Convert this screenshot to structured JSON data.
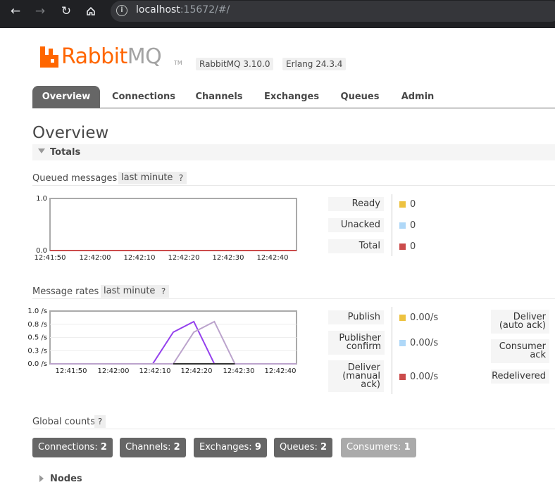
{
  "browser": {
    "url_host": "localhost",
    "url_rest": ":15672/#/"
  },
  "brand": {
    "logo_rabbit": "Rabbit",
    "logo_mq": "MQ",
    "logo_tm": "TM",
    "rabbitmq_version": "RabbitMQ 3.10.0",
    "erlang_version": "Erlang 24.3.4",
    "accent_color": "#ff6600"
  },
  "tabs": [
    {
      "label": "Overview",
      "active": true
    },
    {
      "label": "Connections"
    },
    {
      "label": "Channels"
    },
    {
      "label": "Exchanges"
    },
    {
      "label": "Queues"
    },
    {
      "label": "Admin"
    }
  ],
  "page": {
    "title": "Overview",
    "totals_label": "Totals",
    "help": "?"
  },
  "queued": {
    "heading": "Queued messages",
    "range": "last minute",
    "stats": [
      {
        "label": "Ready",
        "value": "0",
        "color": "#edc240"
      },
      {
        "label": "Unacked",
        "value": "0",
        "color": "#afd8f8"
      },
      {
        "label": "Total",
        "value": "0",
        "color": "#cb4b4b"
      }
    ]
  },
  "rates": {
    "heading": "Message rates",
    "range": "last minute",
    "stats": [
      {
        "label": "Publish",
        "value": "0.00/s",
        "color": "#edc240"
      },
      {
        "label": "Publisher confirm",
        "value": "0.00/s",
        "color": "#afd8f8"
      },
      {
        "label": "Deliver (manual ack)",
        "value": "0.00/s",
        "color": "#cb4b4b"
      }
    ],
    "stats_right": [
      {
        "label": "Deliver (auto ack)"
      },
      {
        "label": "Consumer ack"
      },
      {
        "label": "Redelivered"
      }
    ]
  },
  "global": {
    "heading": "Global counts",
    "counts": [
      {
        "label": "Connections:",
        "value": "2"
      },
      {
        "label": "Channels:",
        "value": "2"
      },
      {
        "label": "Exchanges:",
        "value": "9"
      },
      {
        "label": "Queues:",
        "value": "2"
      },
      {
        "label": "Consumers:",
        "value": "1"
      }
    ]
  },
  "nodes": {
    "label": "Nodes"
  },
  "chart_data": [
    {
      "type": "line",
      "title": "Queued messages",
      "x": [
        "12:41:50",
        "12:42:00",
        "12:42:10",
        "12:42:20",
        "12:42:30",
        "12:42:40"
      ],
      "ylim": [
        0,
        1
      ],
      "yticks": [
        "0.0",
        "1.0"
      ],
      "series": [
        {
          "name": "Ready",
          "color": "#edc240",
          "values": [
            0,
            0,
            0,
            0,
            0,
            0
          ]
        },
        {
          "name": "Unacked",
          "color": "#afd8f8",
          "values": [
            0,
            0,
            0,
            0,
            0,
            0
          ]
        },
        {
          "name": "Total",
          "color": "#cb4b4b",
          "values": [
            0,
            0,
            0,
            0,
            0,
            0
          ]
        }
      ]
    },
    {
      "type": "line",
      "title": "Message rates",
      "x": [
        "12:41:50",
        "12:42:00",
        "12:42:10",
        "12:42:20",
        "12:42:30",
        "12:42:40"
      ],
      "ylim": [
        0,
        1
      ],
      "yticks": [
        "0.0 /s",
        "0.3 /s",
        "0.5 /s",
        "0.8 /s",
        "1.0 /s"
      ],
      "series": [
        {
          "color": "#9440ed",
          "points": [
            [
              0,
              0
            ],
            [
              25,
              0
            ],
            [
              30,
              0.6
            ],
            [
              35,
              0.8
            ],
            [
              40,
              0
            ],
            [
              60,
              0
            ]
          ]
        },
        {
          "color": "#bba3cc",
          "points": [
            [
              0,
              0
            ],
            [
              30,
              0
            ],
            [
              35,
              0.6
            ],
            [
              40,
              0.8
            ],
            [
              45,
              0
            ],
            [
              60,
              0
            ]
          ]
        },
        {
          "color": "#333333",
          "points": [
            [
              30,
              0
            ],
            [
              45,
              0
            ]
          ]
        }
      ]
    }
  ]
}
